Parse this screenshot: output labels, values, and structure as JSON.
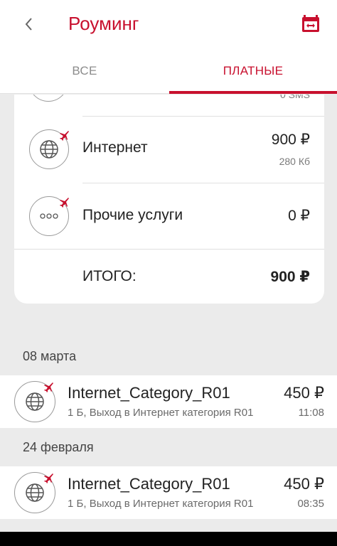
{
  "header": {
    "title": "Роуминг",
    "back_icon": "chevron-left-icon",
    "calendar_icon": "calendar-icon",
    "accent_color": "#c8102e"
  },
  "tabs": [
    {
      "label": "ВСЕ",
      "active": false
    },
    {
      "label": "ПЛАТНЫЕ",
      "active": true
    }
  ],
  "summary": {
    "partial_row": {
      "sub": "0 SMS"
    },
    "rows": [
      {
        "label": "Интернет",
        "amount": "900 ₽",
        "sub": "280 Кб",
        "icon": "globe-icon"
      },
      {
        "label": "Прочие услуги",
        "amount": "0 ₽",
        "icon": "more-dots-icon"
      }
    ],
    "total_label": "ИТОГО:",
    "total_value": "900 ₽"
  },
  "history": [
    {
      "date": "08 марта",
      "items": [
        {
          "name": "Internet_Category_R01",
          "desc": "1 Б, Выход в Интернет категория R01",
          "amount": "450 ₽",
          "time": "11:08",
          "icon": "globe-icon"
        }
      ]
    },
    {
      "date": "24 февраля",
      "items": [
        {
          "name": "Internet_Category_R01",
          "desc": "1 Б, Выход в Интернет категория R01",
          "amount": "450 ₽",
          "time": "08:35",
          "icon": "globe-icon"
        }
      ]
    }
  ]
}
